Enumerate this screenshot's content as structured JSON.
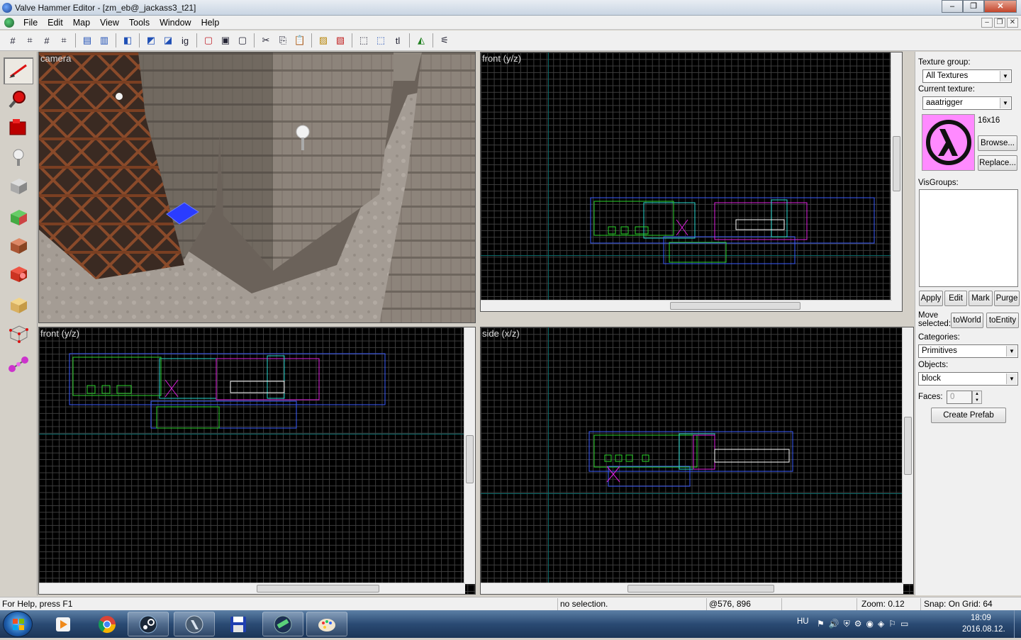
{
  "window": {
    "title": "Valve Hammer Editor - [zm_eb@_jackass3_t21]",
    "controls": [
      "–",
      "❐",
      "✕"
    ]
  },
  "menu": [
    "File",
    "Edit",
    "Map",
    "View",
    "Tools",
    "Window",
    "Help"
  ],
  "mdi_controls": [
    "–",
    "❐",
    "✕"
  ],
  "toolbar_icons": [
    "grid-toggle-icon",
    "3d-grid-icon",
    "smaller-grid-icon",
    "larger-grid-icon",
    "group-icon",
    "ungroup-icon",
    "carve-icon",
    "hollow-icon",
    "clip-icon",
    "ignore-group-icon",
    "texture-lock-icon",
    "hide-icon",
    "unhide-icon",
    "cut-icon",
    "copy-icon",
    "paste-icon",
    "hollow-brush-icon",
    "tie-to-entity-icon",
    "selection-box-icon",
    "select-by-handle-icon",
    "text-icon",
    "run-map-icon",
    "check-problems-icon"
  ],
  "toolbox_icons": [
    "selection-tool-icon",
    "magnify-tool-icon",
    "camera-tool-icon",
    "entity-tool-icon",
    "block-tool-icon",
    "texture-app-icon",
    "apply-texture-icon",
    "decal-tool-icon",
    "clipping-tool-icon",
    "vertex-tool-icon",
    "path-tool-icon"
  ],
  "viewports": {
    "camera": "camera",
    "top_right": "front (y/z)",
    "bottom_left": "front (y/z)",
    "bottom_right": "side (x/z)"
  },
  "rpanel": {
    "texture_group_label": "Texture group:",
    "texture_group_value": "All Textures",
    "current_texture_label": "Current texture:",
    "current_texture_value": "aaatrigger",
    "texture_size": "16x16",
    "browse": "Browse...",
    "replace": "Replace...",
    "visgroups_label": "VisGroups:",
    "apply": "Apply",
    "edit": "Edit",
    "mark": "Mark",
    "purge": "Purge",
    "move_selected": "Move selected:",
    "to_world": "toWorld",
    "to_entity": "toEntity",
    "categories_label": "Categories:",
    "categories_value": "Primitives",
    "objects_label": "Objects:",
    "objects_value": "block",
    "faces_label": "Faces:",
    "faces_value": "0",
    "create_prefab": "Create Prefab"
  },
  "status": {
    "help": "For Help, press F1",
    "selection": "no selection.",
    "coords": "@576, 896",
    "zoom": "Zoom: 0.12",
    "snap": "Snap: On Grid: 64"
  },
  "taskbar": {
    "apps": [
      "start-orb",
      "media-player-icon",
      "chrome-icon",
      "steam-icon",
      "hl-launcher-icon",
      "save-disk-icon",
      "hammer-icon",
      "paint-icon"
    ],
    "language": "HU",
    "time": "18:09",
    "date": "2016.08.12."
  },
  "colors": {
    "grid": "#3d3d3d",
    "axis": "#0a6a6a",
    "brush_blue": "#3a5cff",
    "brush_cyan": "#28d8d0",
    "brush_green": "#2bd52b",
    "brush_magenta": "#e020e0",
    "texture_bg": "#ff8aff"
  }
}
